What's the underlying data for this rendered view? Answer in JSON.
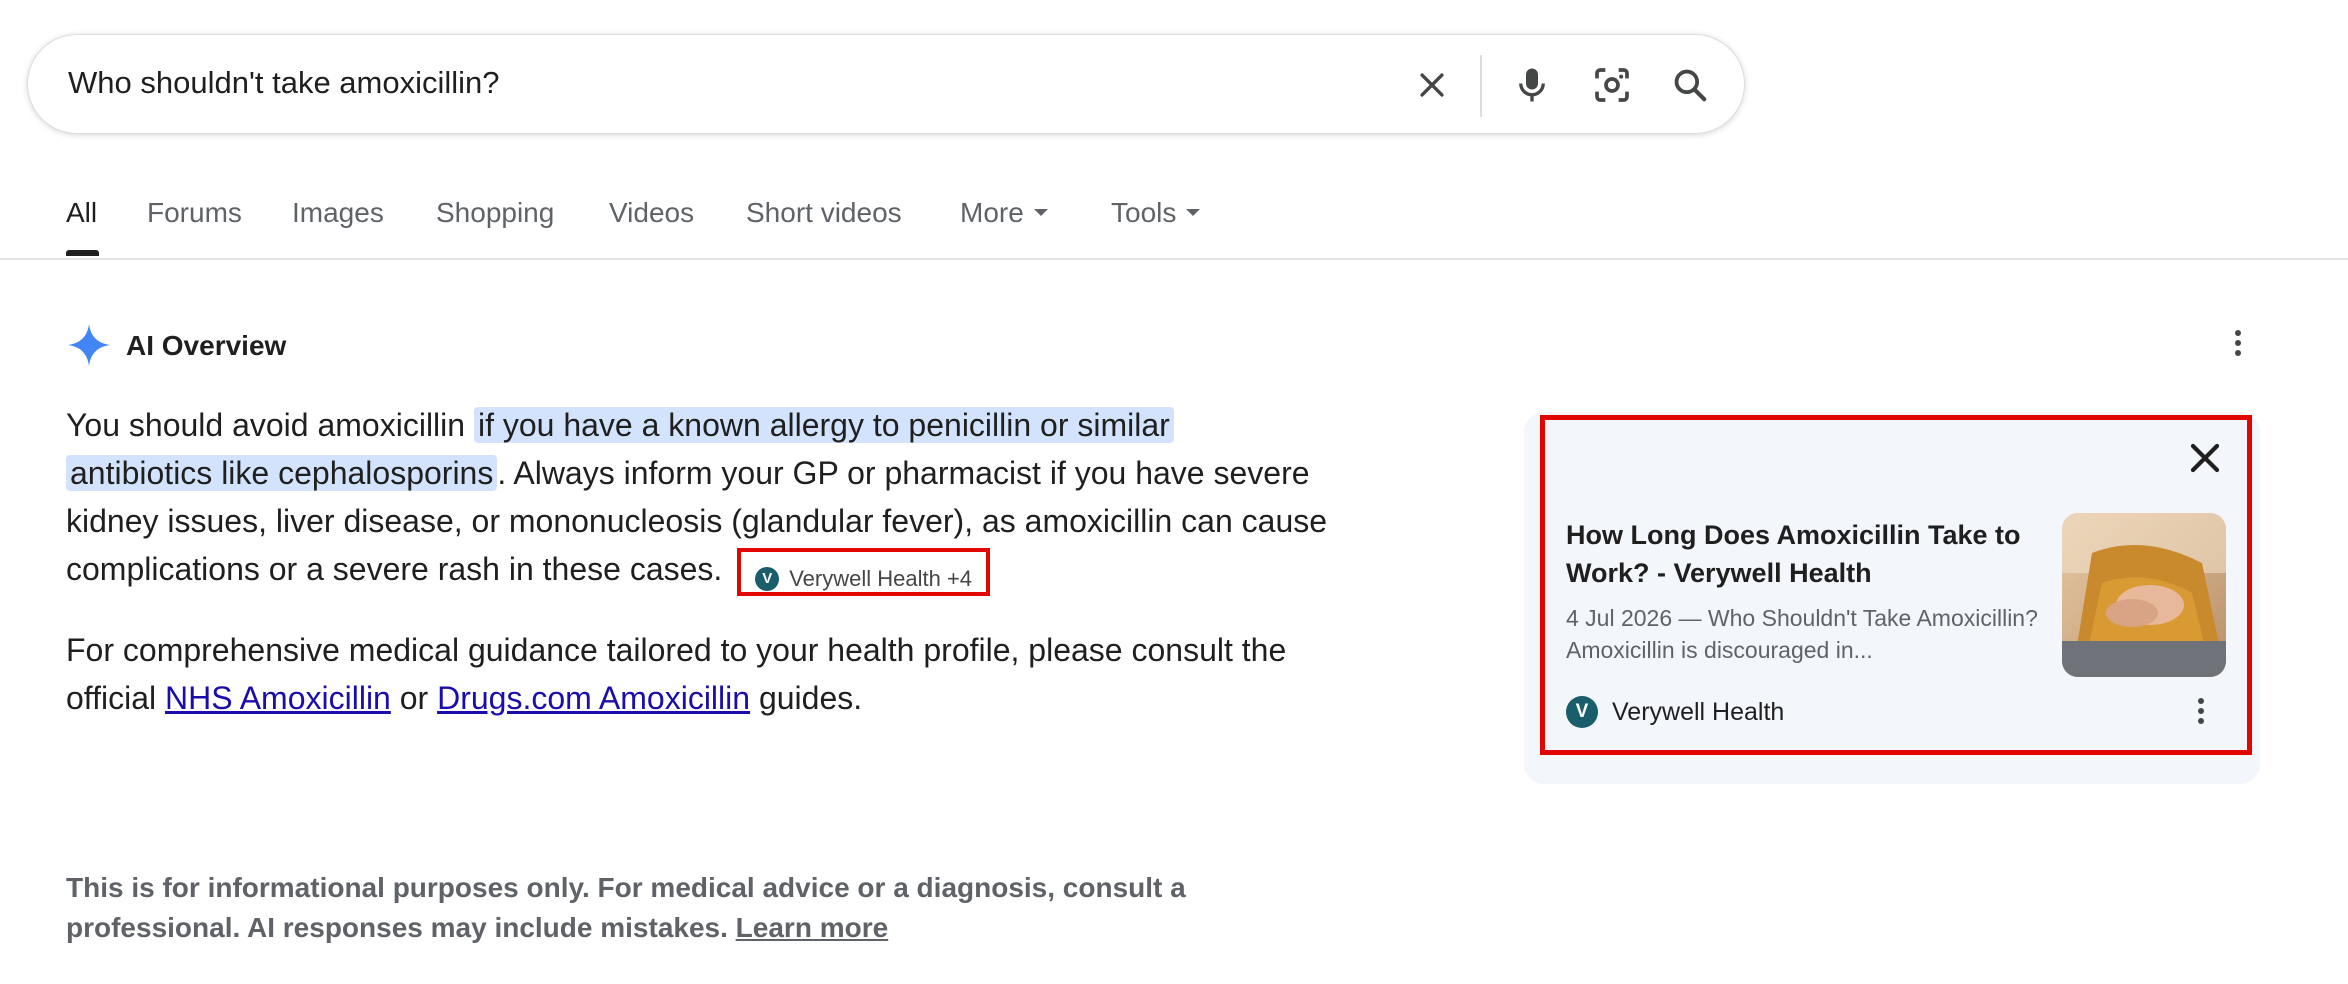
{
  "search": {
    "query": "Who shouldn't take amoxicillin?",
    "icons": [
      "clear-icon",
      "microphone-icon",
      "lens-camera-icon",
      "search-icon"
    ]
  },
  "tabs": [
    {
      "label": "All",
      "active": true
    },
    {
      "label": "Forums"
    },
    {
      "label": "Images"
    },
    {
      "label": "Shopping"
    },
    {
      "label": "Videos"
    },
    {
      "label": "Short videos"
    },
    {
      "label": "More"
    },
    {
      "label": "Tools"
    }
  ],
  "ai_overview": {
    "title": "AI Overview",
    "p1_before": "You should avoid amoxicillin ",
    "p1_highlight_line1": "if you have a known allergy to penicillin or similar",
    "p1_highlight_line2": "antibiotics like cephalosporins",
    "p1_after": ". Always inform your GP or pharmacist if you have severe kidney issues, liver disease, or mononucleosis (glandular fever), as amoxicillin can cause complications or a severe rash in these cases.",
    "citation_chip": "Verywell Health +4",
    "p2_before": "For comprehensive medical guidance tailored to your health profile, please consult the official ",
    "p2_link1": "NHS Amoxicillin",
    "p2_mid": " or ",
    "p2_link2": "Drugs.com Amoxicillin",
    "p2_after": " guides.",
    "disclaimer": "This is for informational purposes only. For medical advice or a diagnosis, consult a professional. AI responses may include mistakes. ",
    "learn_more": "Learn more"
  },
  "source_card": {
    "title": "How Long Does Amoxicillin Take to Work? - Verywell Health",
    "snippet": "4 Jul 2026 — Who Shouldn't Take Amoxicillin? Amoxicillin is discouraged in...",
    "source_name": "Verywell Health",
    "logo_letter": "V"
  },
  "colors": {
    "highlight": "#d3e3fd",
    "link": "#1a0dab",
    "annotation_border": "#e10600",
    "ai_star": "#4285f4"
  }
}
